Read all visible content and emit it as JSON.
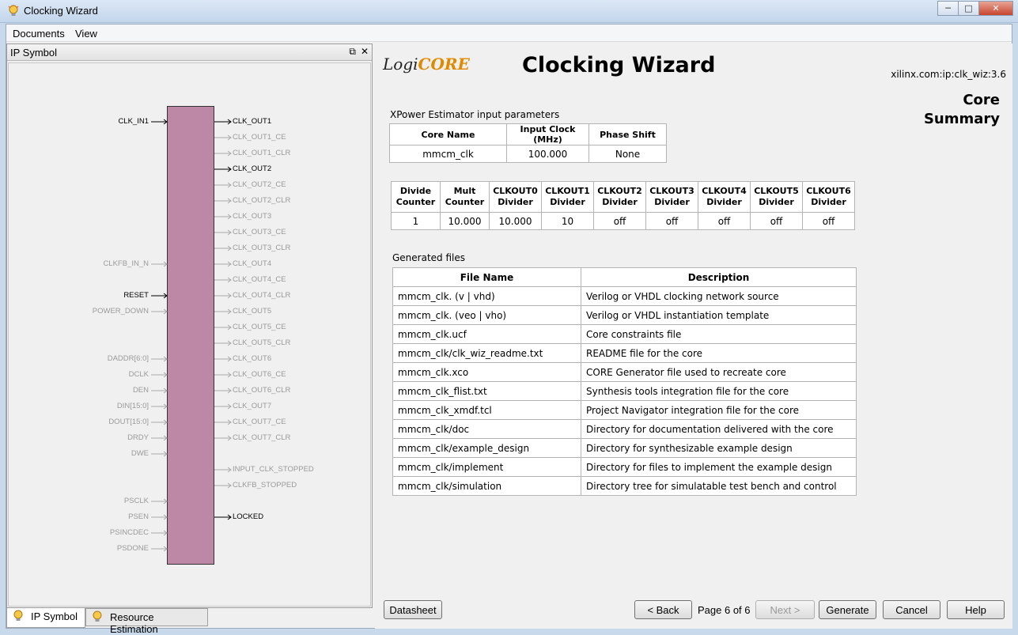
{
  "window": {
    "title": "Clocking Wizard"
  },
  "menu": {
    "documents": "Documents",
    "view": "View"
  },
  "left_panel": {
    "title": "IP Symbol",
    "input_pins": [
      {
        "label": "CLK_IN1",
        "active": true
      },
      {
        "label": "CLKFB_IN_N",
        "active": false
      },
      {
        "label": "RESET",
        "active": true
      },
      {
        "label": "POWER_DOWN",
        "active": false
      },
      {
        "label": "DADDR[6:0]",
        "active": false
      },
      {
        "label": "DCLK",
        "active": false
      },
      {
        "label": "DEN",
        "active": false
      },
      {
        "label": "DIN[15:0]",
        "active": false
      },
      {
        "label": "DOUT[15:0]",
        "active": false
      },
      {
        "label": "DRDY",
        "active": false
      },
      {
        "label": "DWE",
        "active": false
      },
      {
        "label": "PSCLK",
        "active": false
      },
      {
        "label": "PSEN",
        "active": false
      },
      {
        "label": "PSINCDEC",
        "active": false
      },
      {
        "label": "PSDONE",
        "active": false
      }
    ],
    "output_pins": [
      {
        "label": "CLK_OUT1",
        "active": true
      },
      {
        "label": "CLK_OUT1_CE",
        "active": false
      },
      {
        "label": "CLK_OUT1_CLR",
        "active": false
      },
      {
        "label": "CLK_OUT2",
        "active": true
      },
      {
        "label": "CLK_OUT2_CE",
        "active": false
      },
      {
        "label": "CLK_OUT2_CLR",
        "active": false
      },
      {
        "label": "CLK_OUT3",
        "active": false
      },
      {
        "label": "CLK_OUT3_CE",
        "active": false
      },
      {
        "label": "CLK_OUT3_CLR",
        "active": false
      },
      {
        "label": "CLK_OUT4",
        "active": false
      },
      {
        "label": "CLK_OUT4_CE",
        "active": false
      },
      {
        "label": "CLK_OUT4_CLR",
        "active": false
      },
      {
        "label": "CLK_OUT5",
        "active": false
      },
      {
        "label": "CLK_OUT5_CE",
        "active": false
      },
      {
        "label": "CLK_OUT5_CLR",
        "active": false
      },
      {
        "label": "CLK_OUT6",
        "active": false
      },
      {
        "label": "CLK_OUT6_CE",
        "active": false
      },
      {
        "label": "CLK_OUT6_CLR",
        "active": false
      },
      {
        "label": "CLK_OUT7",
        "active": false
      },
      {
        "label": "CLK_OUT7_CE",
        "active": false
      },
      {
        "label": "CLK_OUT7_CLR",
        "active": false
      },
      {
        "label": "INPUT_CLK_STOPPED",
        "active": false
      },
      {
        "label": "CLKFB_STOPPED",
        "active": false
      },
      {
        "label": "LOCKED",
        "active": true
      }
    ],
    "tabs": {
      "ip_symbol": "IP Symbol",
      "resource_estimation": "Resource Estimation"
    }
  },
  "right_panel": {
    "logo_logi": "Logi",
    "logo_core": "CORE",
    "title": "Clocking Wizard",
    "ip_version": "xilinx.com:ip:clk_wiz:3.6",
    "summary_line1": "Core",
    "summary_line2": "Summary",
    "xpower": {
      "label": "XPower Estimator input parameters",
      "headers": [
        "Core Name",
        "Input Clock (MHz)",
        "Phase Shift"
      ],
      "row": [
        "mmcm_clk",
        "100.000",
        "None"
      ]
    },
    "dividers": {
      "headers": [
        [
          "Divide",
          "Counter"
        ],
        [
          "Mult",
          "Counter"
        ],
        [
          "CLKOUT0",
          "Divider"
        ],
        [
          "CLKOUT1",
          "Divider"
        ],
        [
          "CLKOUT2",
          "Divider"
        ],
        [
          "CLKOUT3",
          "Divider"
        ],
        [
          "CLKOUT4",
          "Divider"
        ],
        [
          "CLKOUT5",
          "Divider"
        ],
        [
          "CLKOUT6",
          "Divider"
        ]
      ],
      "row": [
        "1",
        "10.000",
        "10.000",
        "10",
        "off",
        "off",
        "off",
        "off",
        "off"
      ]
    },
    "files": {
      "label": "Generated files",
      "headers": [
        "File Name",
        "Description"
      ],
      "rows": [
        [
          "mmcm_clk. (v | vhd)",
          "Verilog or VHDL clocking network source"
        ],
        [
          "mmcm_clk. (veo | vho)",
          "Verilog or VHDL instantiation template"
        ],
        [
          "mmcm_clk.ucf",
          "Core constraints file"
        ],
        [
          "mmcm_clk/clk_wiz_readme.txt",
          "README file for the core"
        ],
        [
          "mmcm_clk.xco",
          "CORE Generator file used to recreate core"
        ],
        [
          "mmcm_clk_flist.txt",
          "Synthesis tools integration file for the core"
        ],
        [
          "mmcm_clk_xmdf.tcl",
          "Project Navigator integration file for the core"
        ],
        [
          "mmcm_clk/doc",
          "Directory for documentation delivered with the core"
        ],
        [
          "mmcm_clk/example_design",
          "Directory for synthesizable example design"
        ],
        [
          "mmcm_clk/implement",
          "Directory for files to implement the example design"
        ],
        [
          "mmcm_clk/simulation",
          "Directory tree for simulatable test bench and control"
        ]
      ]
    },
    "buttons": {
      "datasheet": "Datasheet",
      "back": "< Back",
      "page": "Page 6 of 6",
      "next": "Next >",
      "generate": "Generate",
      "cancel": "Cancel",
      "help": "Help"
    }
  }
}
